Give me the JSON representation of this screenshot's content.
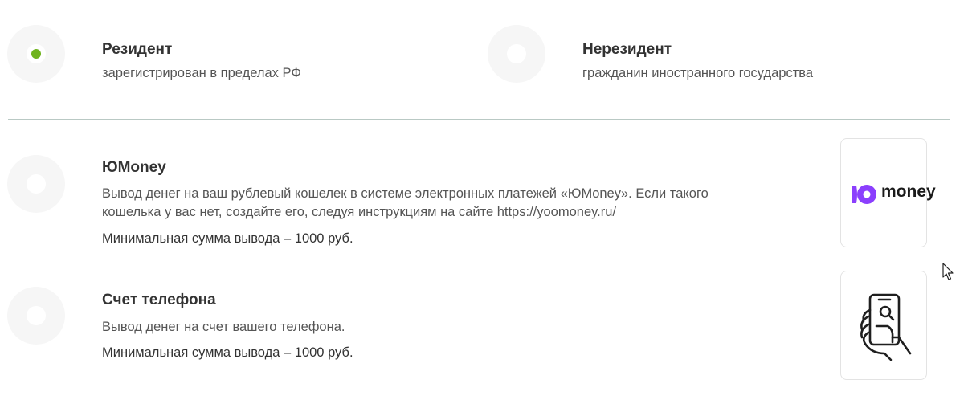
{
  "residency": {
    "options": [
      {
        "title": "Резидент",
        "description": "зарегистрирован в пределах РФ",
        "selected": true
      },
      {
        "title": "Нерезидент",
        "description": "гражданин иностранного государства",
        "selected": false
      }
    ]
  },
  "payout": {
    "options": [
      {
        "title": "ЮMoney",
        "description_line1": "Вывод денег на ваш рублевый кошелек в системе электронных платежей «ЮMoney». Если такого",
        "description_line2": "кошелька у вас нет, создайте его, следуя инструкциям на сайте https://yoomoney.ru/",
        "min_amount": "Минимальная сумма вывода – 1000 руб.",
        "logo_text": "money",
        "icon": "yoomoney-logo-icon",
        "selected": false
      },
      {
        "title": "Счет телефона",
        "description_line1": "Вывод денег на счет вашего телефона.",
        "min_amount": "Минимальная сумма вывода – 1000 руб.",
        "icon": "phone-in-hand-icon",
        "selected": false
      }
    ]
  },
  "colors": {
    "selected_dot": "#6fb31d",
    "yoomoney_brand": "#8b3ffd",
    "divider": "#b9c9c4"
  }
}
